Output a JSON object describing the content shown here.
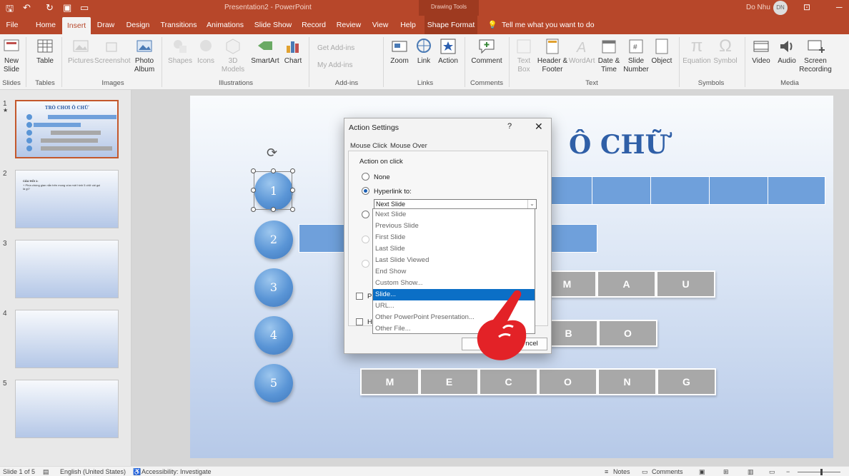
{
  "app": {
    "doc_title": "Presentation2  -  PowerPoint",
    "contextual": "Drawing Tools",
    "user": "Do Nhu",
    "avatar": "DN"
  },
  "tabs": [
    "File",
    "Home",
    "Insert",
    "Draw",
    "Design",
    "Transitions",
    "Animations",
    "Slide Show",
    "Record",
    "Review",
    "View",
    "Help",
    "Shape Format"
  ],
  "active_tab": "Insert",
  "tell_me": "Tell me what you want to do",
  "ribbon": {
    "new_slide": "New Slide",
    "table": "Table",
    "pictures": "Pictures",
    "screenshot": "Screenshot",
    "photo_album": "Photo Album",
    "shapes": "Shapes",
    "icons": "Icons",
    "models3d": "3D Models",
    "smartart": "SmartArt",
    "chart": "Chart",
    "get_addins": "Get Add-ins",
    "my_addins": "My Add-ins",
    "zoom": "Zoom",
    "link": "Link",
    "action": "Action",
    "comment": "Comment",
    "text_box": "Text Box",
    "header_footer": "Header & Footer",
    "wordart": "WordArt",
    "date_time": "Date & Time",
    "slide_number": "Slide Number",
    "object": "Object",
    "equation": "Equation",
    "symbol": "Symbol",
    "video": "Video",
    "audio": "Audio",
    "screen_recording": "Screen Recording",
    "groups": {
      "slides": "Slides",
      "tables": "Tables",
      "images": "Images",
      "illustrations": "Illustrations",
      "addins": "Add-ins",
      "links": "Links",
      "comments": "Comments",
      "text": "Text",
      "symbols": "Symbols",
      "media": "Media"
    }
  },
  "thumbnails": [
    {
      "num": "1",
      "title": "TRÒ CHƠI Ô CHỮ"
    },
    {
      "num": "2",
      "title": "CÂU HỎI 1:",
      "body": "+ Phía chúng gian nắn trên mong vừa mới hình 5 chữ cái gọi là gì?"
    },
    {
      "num": "3"
    },
    {
      "num": "4"
    },
    {
      "num": "5"
    }
  ],
  "slide": {
    "title": "Ô CHỮ",
    "circles": [
      "1",
      "2",
      "3",
      "4",
      "5"
    ],
    "row3": [
      "M",
      "A",
      "U"
    ],
    "row4": [
      "B",
      "O"
    ],
    "row5": [
      "M",
      "E",
      "C",
      "O",
      "N",
      "G"
    ]
  },
  "dialog": {
    "title": "Action Settings",
    "help": "?",
    "close": "✕",
    "tabs": [
      "Mouse Click",
      "Mouse Over"
    ],
    "section": "Action on click",
    "none": "None",
    "hyperlink": "Hyperlink to:",
    "combo_value": "Next Slide",
    "options": [
      "Next Slide",
      "Previous Slide",
      "First Slide",
      "Last Slide",
      "Last Slide Viewed",
      "End Show",
      "Custom Show...",
      "Slide...",
      "URL...",
      "Other PowerPoint Presentation...",
      "Other File..."
    ],
    "highlighted": "Slide...",
    "frag_play": "Pl",
    "frag_hi": "Hi",
    "cancel_frag": "ncel"
  },
  "status": {
    "slide": "Slide 1 of 5",
    "lang": "English (United States)",
    "access": "Accessibility: Investigate",
    "notes": "Notes",
    "comments": "Comments"
  }
}
